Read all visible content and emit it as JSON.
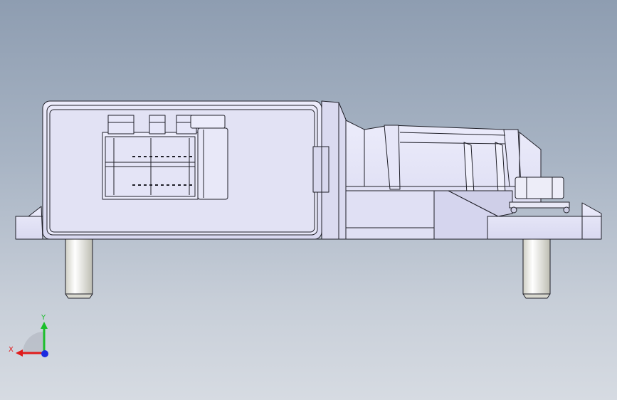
{
  "viewport": {
    "background_top": "#8e9db1",
    "background_bottom": "#d6dbe2"
  },
  "model": {
    "body_color": "#e3e3f6",
    "edge_color": "#1f1f28",
    "shade_color": "#c9c9e4",
    "pin_color": "#f2f2ea"
  },
  "triad": {
    "x_label": "X",
    "y_label": "Y",
    "x_color": "#e01b1b",
    "y_color": "#1bbf2b",
    "z_color": "#1b2be0"
  }
}
